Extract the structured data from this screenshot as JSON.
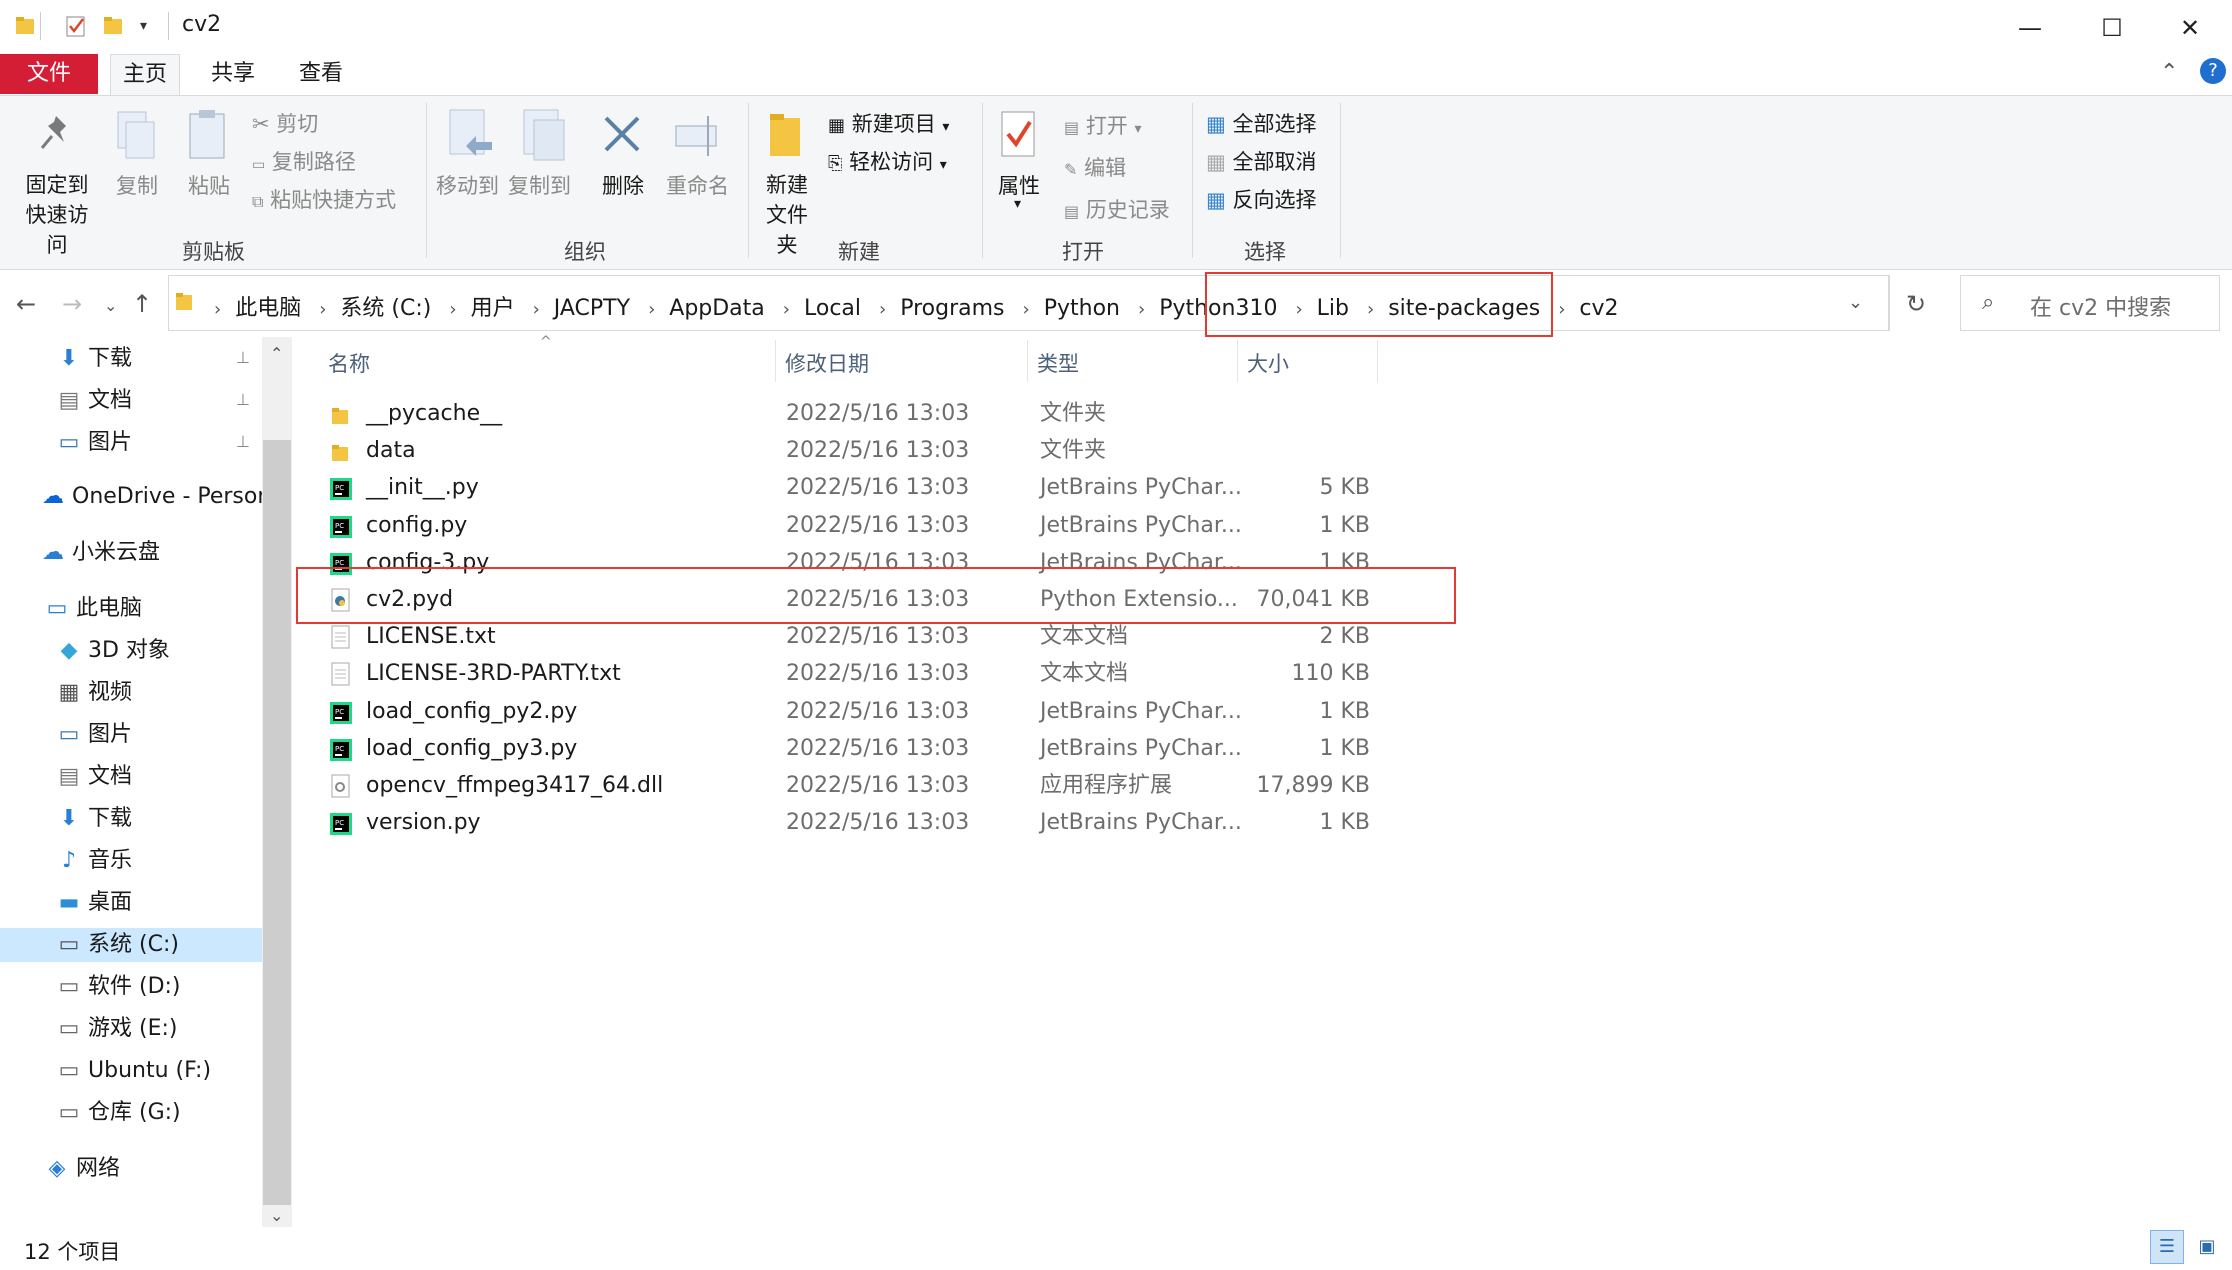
{
  "window": {
    "title": "cv2"
  },
  "tabs": {
    "file": "文件",
    "home": "主页",
    "share": "共享",
    "view": "查看"
  },
  "ribbon": {
    "clipboard": {
      "pin": [
        "固定到",
        "快速访问"
      ],
      "copy": "复制",
      "paste": "粘贴",
      "cut": "剪切",
      "copy_path": "复制路径",
      "paste_shortcut": "粘贴快捷方式",
      "label": "剪贴板"
    },
    "organize": {
      "move_to": "移动到",
      "copy_to": "复制到",
      "delete": "删除",
      "rename": "重命名",
      "label": "组织"
    },
    "new": {
      "new_folder": [
        "新建",
        "文件夹"
      ],
      "new_item": "新建项目",
      "easy_access": "轻松访问",
      "label": "新建"
    },
    "open": {
      "properties": "属性",
      "open": "打开",
      "edit": "编辑",
      "history": "历史记录",
      "label": "打开"
    },
    "select": {
      "select_all": "全部选择",
      "select_none": "全部取消",
      "invert": "反向选择",
      "label": "选择"
    }
  },
  "address": {
    "crumbs": [
      "此电脑",
      "系统 (C:)",
      "用户",
      "JACPTY",
      "AppData",
      "Local",
      "Programs",
      "Python",
      "Python310",
      "Lib",
      "site-packages",
      "cv2"
    ],
    "search_placeholder": "在 cv2 中搜索"
  },
  "sidebar": {
    "quick": [
      {
        "label": "下载",
        "icon": "download-icon"
      },
      {
        "label": "文档",
        "icon": "document-icon"
      },
      {
        "label": "图片",
        "icon": "picture-icon"
      }
    ],
    "onedrive": "OneDrive - Person",
    "xiaomi": "小米云盘",
    "this_pc": "此电脑",
    "pc_items": [
      {
        "label": "3D 对象",
        "icon": "cube-icon"
      },
      {
        "label": "视频",
        "icon": "video-icon"
      },
      {
        "label": "图片",
        "icon": "picture-icon"
      },
      {
        "label": "文档",
        "icon": "document-icon"
      },
      {
        "label": "下载",
        "icon": "download-icon"
      },
      {
        "label": "音乐",
        "icon": "music-icon"
      },
      {
        "label": "桌面",
        "icon": "desktop-icon"
      },
      {
        "label": "系统 (C:)",
        "icon": "windows-drive-icon"
      },
      {
        "label": "软件 (D:)",
        "icon": "drive-icon"
      },
      {
        "label": "游戏 (E:)",
        "icon": "drive-icon"
      },
      {
        "label": "Ubuntu (F:)",
        "icon": "drive-icon"
      },
      {
        "label": "仓库 (G:)",
        "icon": "drive-icon"
      }
    ],
    "network": "网络"
  },
  "columns": {
    "name": "名称",
    "modified": "修改日期",
    "type": "类型",
    "size": "大小"
  },
  "files": [
    {
      "name": "__pycache__",
      "date": "2022/5/16 13:03",
      "type": "文件夹",
      "size": "",
      "icon": "folder-icon"
    },
    {
      "name": "data",
      "date": "2022/5/16 13:03",
      "type": "文件夹",
      "size": "",
      "icon": "folder-icon"
    },
    {
      "name": "__init__.py",
      "date": "2022/5/16 13:03",
      "type": "JetBrains PyChar...",
      "size": "5 KB",
      "icon": "pycharm-icon"
    },
    {
      "name": "config.py",
      "date": "2022/5/16 13:03",
      "type": "JetBrains PyChar...",
      "size": "1 KB",
      "icon": "pycharm-icon"
    },
    {
      "name": "config-3.py",
      "date": "2022/5/16 13:03",
      "type": "JetBrains PyChar...",
      "size": "1 KB",
      "icon": "pycharm-icon"
    },
    {
      "name": "cv2.pyd",
      "date": "2022/5/16 13:03",
      "type": "Python Extensio...",
      "size": "70,041 KB",
      "icon": "python-extension-icon"
    },
    {
      "name": "LICENSE.txt",
      "date": "2022/5/16 13:03",
      "type": "文本文档",
      "size": "2 KB",
      "icon": "text-file-icon"
    },
    {
      "name": "LICENSE-3RD-PARTY.txt",
      "date": "2022/5/16 13:03",
      "type": "文本文档",
      "size": "110 KB",
      "icon": "text-file-icon"
    },
    {
      "name": "load_config_py2.py",
      "date": "2022/5/16 13:03",
      "type": "JetBrains PyChar...",
      "size": "1 KB",
      "icon": "pycharm-icon"
    },
    {
      "name": "load_config_py3.py",
      "date": "2022/5/16 13:03",
      "type": "JetBrains PyChar...",
      "size": "1 KB",
      "icon": "pycharm-icon"
    },
    {
      "name": "opencv_ffmpeg3417_64.dll",
      "date": "2022/5/16 13:03",
      "type": "应用程序扩展",
      "size": "17,899 KB",
      "icon": "dll-icon"
    },
    {
      "name": "version.py",
      "date": "2022/5/16 13:03",
      "type": "JetBrains PyChar...",
      "size": "1 KB",
      "icon": "pycharm-icon"
    }
  ],
  "status": {
    "count": "12 个项目"
  },
  "colors": {
    "file_tab": "#d31e36",
    "highlight_box": "#e53935",
    "pycharm_green": "#21d789"
  }
}
